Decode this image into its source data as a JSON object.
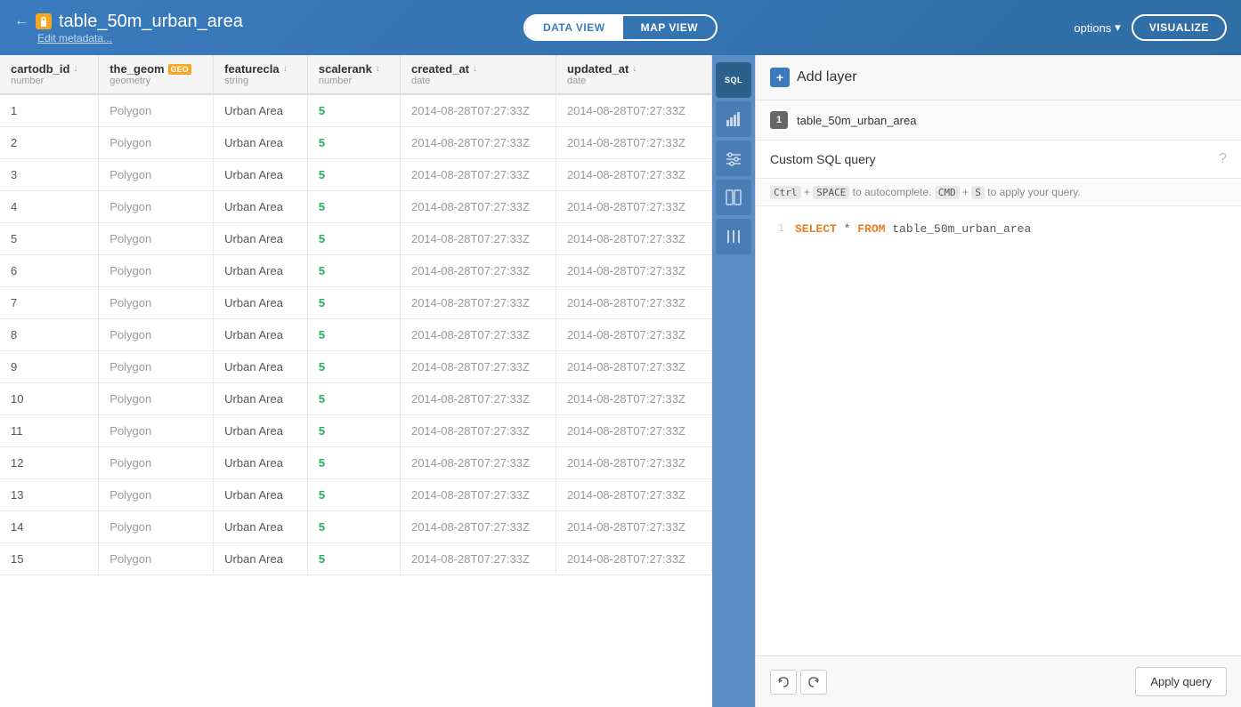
{
  "header": {
    "back_icon": "←",
    "lock_icon": "🔒",
    "title": "table_50m_urban_area",
    "subtitle": "Edit metadata...",
    "views": [
      {
        "label": "DATA VIEW",
        "active": true
      },
      {
        "label": "MAP VIEW",
        "active": false
      }
    ],
    "options_label": "options",
    "options_arrow": "▾",
    "visualize_label": "VISUALIZE"
  },
  "table": {
    "columns": [
      {
        "name": "cartodb_id",
        "sort": "↓",
        "type": "number",
        "badge": null
      },
      {
        "name": "the_geom",
        "sort": null,
        "type": "geometry",
        "badge": "GEO"
      },
      {
        "name": "featurecla",
        "sort": "↓",
        "type": "string",
        "badge": null
      },
      {
        "name": "scalerank",
        "sort": "↓",
        "type": "number",
        "badge": null
      },
      {
        "name": "created_at",
        "sort": "↓",
        "type": "date",
        "badge": null
      },
      {
        "name": "updated_at",
        "sort": "↓",
        "type": "date",
        "badge": null
      }
    ],
    "rows": [
      {
        "id": 1,
        "geom": "Polygon",
        "feature": "Urban Area",
        "scale": "5",
        "created": "2014-08-28T07:27:33Z",
        "updated": "2014-08-28T07:27:33Z"
      },
      {
        "id": 2,
        "geom": "Polygon",
        "feature": "Urban Area",
        "scale": "5",
        "created": "2014-08-28T07:27:33Z",
        "updated": "2014-08-28T07:27:33Z"
      },
      {
        "id": 3,
        "geom": "Polygon",
        "feature": "Urban Area",
        "scale": "5",
        "created": "2014-08-28T07:27:33Z",
        "updated": "2014-08-28T07:27:33Z"
      },
      {
        "id": 4,
        "geom": "Polygon",
        "feature": "Urban Area",
        "scale": "5",
        "created": "2014-08-28T07:27:33Z",
        "updated": "2014-08-28T07:27:33Z"
      },
      {
        "id": 5,
        "geom": "Polygon",
        "feature": "Urban Area",
        "scale": "5",
        "created": "2014-08-28T07:27:33Z",
        "updated": "2014-08-28T07:27:33Z"
      },
      {
        "id": 6,
        "geom": "Polygon",
        "feature": "Urban Area",
        "scale": "5",
        "created": "2014-08-28T07:27:33Z",
        "updated": "2014-08-28T07:27:33Z"
      },
      {
        "id": 7,
        "geom": "Polygon",
        "feature": "Urban Area",
        "scale": "5",
        "created": "2014-08-28T07:27:33Z",
        "updated": "2014-08-28T07:27:33Z"
      },
      {
        "id": 8,
        "geom": "Polygon",
        "feature": "Urban Area",
        "scale": "5",
        "created": "2014-08-28T07:27:33Z",
        "updated": "2014-08-28T07:27:33Z"
      },
      {
        "id": 9,
        "geom": "Polygon",
        "feature": "Urban Area",
        "scale": "5",
        "created": "2014-08-28T07:27:33Z",
        "updated": "2014-08-28T07:27:33Z"
      },
      {
        "id": 10,
        "geom": "Polygon",
        "feature": "Urban Area",
        "scale": "5",
        "created": "2014-08-28T07:27:33Z",
        "updated": "2014-08-28T07:27:33Z"
      },
      {
        "id": 11,
        "geom": "Polygon",
        "feature": "Urban Area",
        "scale": "5",
        "created": "2014-08-28T07:27:33Z",
        "updated": "2014-08-28T07:27:33Z"
      },
      {
        "id": 12,
        "geom": "Polygon",
        "feature": "Urban Area",
        "scale": "5",
        "created": "2014-08-28T07:27:33Z",
        "updated": "2014-08-28T07:27:33Z"
      },
      {
        "id": 13,
        "geom": "Polygon",
        "feature": "Urban Area",
        "scale": "5",
        "created": "2014-08-28T07:27:33Z",
        "updated": "2014-08-28T07:27:33Z"
      },
      {
        "id": 14,
        "geom": "Polygon",
        "feature": "Urban Area",
        "scale": "5",
        "created": "2014-08-28T07:27:33Z",
        "updated": "2014-08-28T07:27:33Z"
      },
      {
        "id": 15,
        "geom": "Polygon",
        "feature": "Urban Area",
        "scale": "5",
        "created": "2014-08-28T07:27:33Z",
        "updated": "2014-08-28T07:27:33Z"
      }
    ]
  },
  "sidebar": {
    "tools": [
      {
        "name": "sql",
        "label": "SQL",
        "active": true
      },
      {
        "name": "chart",
        "label": "📊",
        "active": false
      },
      {
        "name": "filter",
        "label": "⚡",
        "active": false
      },
      {
        "name": "merge",
        "label": "⊞",
        "active": false
      },
      {
        "name": "column",
        "label": "|||",
        "active": false
      }
    ]
  },
  "add_layer": {
    "icon": "+",
    "title": "Add layer",
    "layer": {
      "number": "1",
      "name": "table_50m_urban_area"
    }
  },
  "sql_editor": {
    "title": "Custom SQL query",
    "hint": "Ctrl + SPACE to autocomplete. CMD + S to apply your query.",
    "hint_parts": {
      "ctrl": "Ctrl",
      "space": "SPACE",
      "autocomplete": "to autocomplete.",
      "cmd": "CMD",
      "s": "S",
      "apply": "to apply your query."
    },
    "line_number": "1",
    "query_select": "SELECT",
    "query_star": " * ",
    "query_from": "FROM",
    "query_table": " table_50m_urban_area"
  },
  "footer": {
    "undo_icon": "↩",
    "redo_icon": "↪",
    "apply_query_label": "Apply query"
  }
}
